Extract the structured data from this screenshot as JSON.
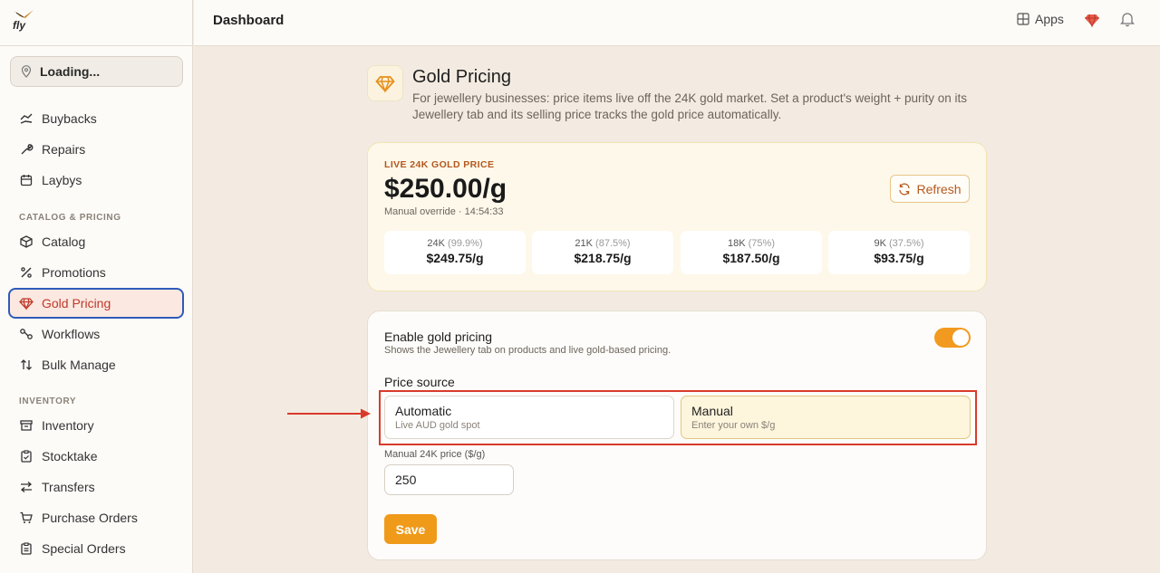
{
  "app": {
    "logo_text": "fly"
  },
  "sidebar": {
    "location": "Loading...",
    "items_top": [
      {
        "label": "Buybacks",
        "icon": "buyback-icon"
      },
      {
        "label": "Repairs",
        "icon": "wrench-icon"
      },
      {
        "label": "Laybys",
        "icon": "calendar-icon"
      }
    ],
    "section_catalog": "CATALOG & PRICING",
    "items_catalog": [
      {
        "label": "Catalog",
        "icon": "box-icon"
      },
      {
        "label": "Promotions",
        "icon": "percent-icon"
      },
      {
        "label": "Gold Pricing",
        "icon": "gem-icon",
        "active": true
      },
      {
        "label": "Workflows",
        "icon": "workflow-icon"
      },
      {
        "label": "Bulk Manage",
        "icon": "sort-icon"
      }
    ],
    "section_inventory": "INVENTORY",
    "items_inventory": [
      {
        "label": "Inventory",
        "icon": "archive-icon"
      },
      {
        "label": "Stocktake",
        "icon": "clipboard-icon"
      },
      {
        "label": "Transfers",
        "icon": "transfer-icon"
      },
      {
        "label": "Purchase Orders",
        "icon": "cart-icon"
      },
      {
        "label": "Special Orders",
        "icon": "clipboard-list-icon"
      }
    ]
  },
  "header": {
    "title": "Dashboard",
    "apps_label": "Apps"
  },
  "page": {
    "title": "Gold Pricing",
    "description": "For jewellery businesses: price items live off the 24K gold market. Set a product's weight + purity on its Jewellery tab and its selling price tracks the gold price automatically."
  },
  "live_price": {
    "label": "LIVE 24K GOLD PRICE",
    "value": "$250.00/g",
    "meta": "Manual override · 14:54:33",
    "refresh_label": "Refresh",
    "karats": [
      {
        "name": "24K",
        "purity": "(99.9%)",
        "price": "$249.75/g"
      },
      {
        "name": "21K",
        "purity": "(87.5%)",
        "price": "$218.75/g"
      },
      {
        "name": "18K",
        "purity": "(75%)",
        "price": "$187.50/g"
      },
      {
        "name": "9K",
        "purity": "(37.5%)",
        "price": "$93.75/g"
      }
    ]
  },
  "settings": {
    "enable_title": "Enable gold pricing",
    "enable_sub": "Shows the Jewellery tab on products and live gold-based pricing.",
    "enabled": true,
    "source_label": "Price source",
    "options": [
      {
        "title": "Automatic",
        "sub": "Live AUD gold spot",
        "selected": false
      },
      {
        "title": "Manual",
        "sub": "Enter your own $/g",
        "selected": true
      }
    ],
    "manual_label": "Manual 24K price ($/g)",
    "manual_value": "250",
    "save_label": "Save"
  },
  "colors": {
    "accent": "#f09a1a",
    "active_text": "#c0392b",
    "highlight": "#d93a2b"
  }
}
